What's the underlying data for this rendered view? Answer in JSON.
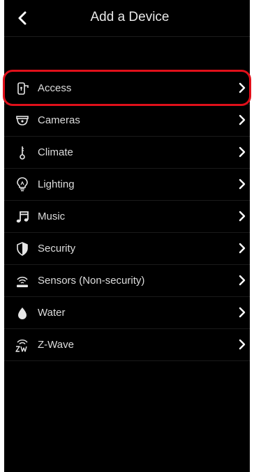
{
  "header": {
    "title": "Add a Device",
    "back_icon": "chevron-left-icon"
  },
  "categories": [
    {
      "label": "Access",
      "icon": "door-lock-icon",
      "highlighted": true
    },
    {
      "label": "Cameras",
      "icon": "camera-dome-icon"
    },
    {
      "label": "Climate",
      "icon": "thermometer-icon"
    },
    {
      "label": "Lighting",
      "icon": "lightbulb-icon"
    },
    {
      "label": "Music",
      "icon": "music-note-icon"
    },
    {
      "label": "Security",
      "icon": "shield-icon"
    },
    {
      "label": "Sensors (Non-security)",
      "icon": "sensor-icon"
    },
    {
      "label": "Water",
      "icon": "water-drop-icon"
    },
    {
      "label": "Z-Wave",
      "icon": "zwave-icon"
    }
  ],
  "colors": {
    "background": "#000000",
    "text": "#dcdcdc",
    "highlight": "#e0101a"
  }
}
